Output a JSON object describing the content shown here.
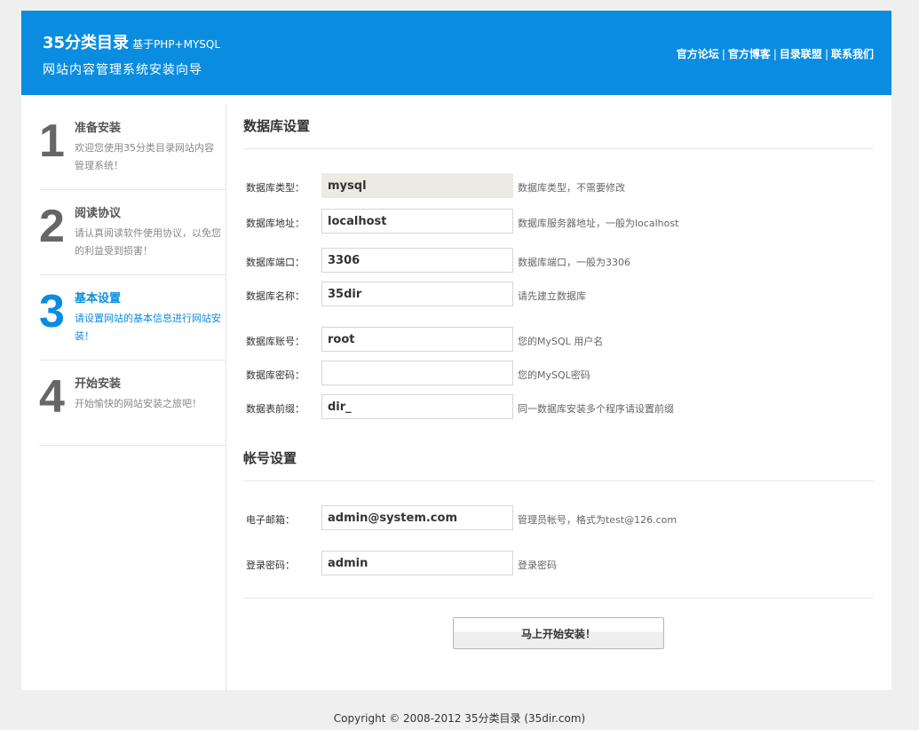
{
  "header": {
    "title": "35分类目录",
    "subtitle": "基于PHP+MYSQL",
    "tagline": "网站内容管理系统安装向导",
    "links": [
      "官方论坛",
      "官方博客",
      "目录联盟",
      "联系我们"
    ],
    "separator": "|"
  },
  "steps": [
    {
      "number": "1",
      "title": "准备安装",
      "desc": "欢迎您使用35分类目录网站内容管理系统！"
    },
    {
      "number": "2",
      "title": "阅读协议",
      "desc": "请认真阅读软件使用协议，以免您的利益受到损害！"
    },
    {
      "number": "3",
      "title": "基本设置",
      "desc": "请设置网站的基本信息进行网站安装！"
    },
    {
      "number": "4",
      "title": "开始安装",
      "desc": "开始愉快的网站安装之旅吧！"
    }
  ],
  "db_section": {
    "title": "数据库设置",
    "fields": [
      {
        "label": "数据库类型：",
        "value": "mysql",
        "hint": "数据库类型，不需要修改"
      },
      {
        "label": "数据库地址：",
        "value": "localhost",
        "hint": "数据库服务器地址，一般为localhost"
      },
      {
        "label": "数据库端口：",
        "value": "3306",
        "hint": "数据库端口，一般为3306"
      },
      {
        "label": "数据库名称：",
        "value": "35dir",
        "hint": "请先建立数据库"
      },
      {
        "label": "数据库账号：",
        "value": "root",
        "hint": "您的MySQL 用户名"
      },
      {
        "label": "数据库密码：",
        "value": "",
        "hint": "您的MySQL密码"
      },
      {
        "label": "数据表前缀：",
        "value": "dir_",
        "hint": "同一数据库安装多个程序请设置前缀"
      }
    ]
  },
  "account_section": {
    "title": "帐号设置",
    "fields": [
      {
        "label": "电子邮箱：",
        "value": "admin@system.com",
        "hint": "管理员帐号，格式为test@126.com"
      },
      {
        "label": "登录密码：",
        "value": "admin",
        "hint": "登录密码"
      }
    ]
  },
  "install_button": "马上开始安装！",
  "footer": "Copyright © 2008-2012 35分类目录 (35dir.com)"
}
